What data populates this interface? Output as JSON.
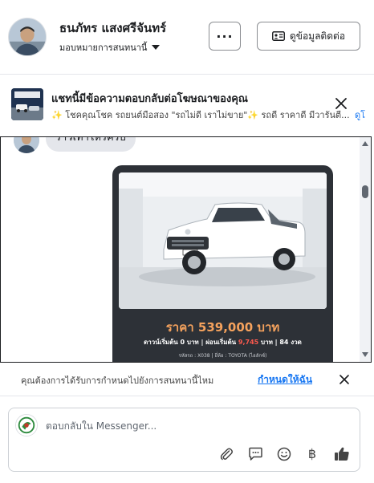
{
  "header": {
    "user_name": "ธนภัทร แสงศรีจันทร์",
    "assign_label": "มอบหมายการสนทนานี้",
    "more_label": "...",
    "contact_label": "ดูข้อมูลติดต่อ"
  },
  "ad_banner": {
    "title": "แชทนี้มีข้อความตอบกลับต่อโฆษณาของคุณ",
    "subtitle": "✨ โชคคุณโชค รถยนต์มือสอง \"รถไม่ดี เราไม่ขาย\"✨ รถดี ราคาดี มีวารันตี...",
    "see_more": "ดูโ"
  },
  "chat": {
    "bubble_text": "ราวเท่าไหร่ครับ",
    "ad_card": {
      "price": "ราคา 539,000 บาท",
      "terms_prefix": "ดาวน์เริ่มต้น 0 บาท | ผ่อนเริ่มต้น ",
      "terms_highlight": "9,745",
      "terms_suffix": " บาท | 84 งวด",
      "meta": "รหัสรถ : X038 | ยี่ห้อ : TOYOTA (ไฮลักซ์)"
    }
  },
  "prompt": {
    "text": "คุณต้องการได้รับการกำหนดไปยังการสนทนานี้ไหม",
    "link": "กำหนดให้ฉัน"
  },
  "composer": {
    "placeholder": "ตอบกลับใน Messenger..."
  },
  "icons": {
    "attach": "paperclip-icon",
    "saved_reply": "chat-bubble-icon",
    "emoji": "smiley-icon",
    "payment": "baht-icon",
    "like": "thumbs-up-icon"
  },
  "colors": {
    "accent": "#1877f2",
    "price": "#f5a25d",
    "installment_highlight": "#ff5a4e",
    "card_bg": "#2d3137"
  }
}
